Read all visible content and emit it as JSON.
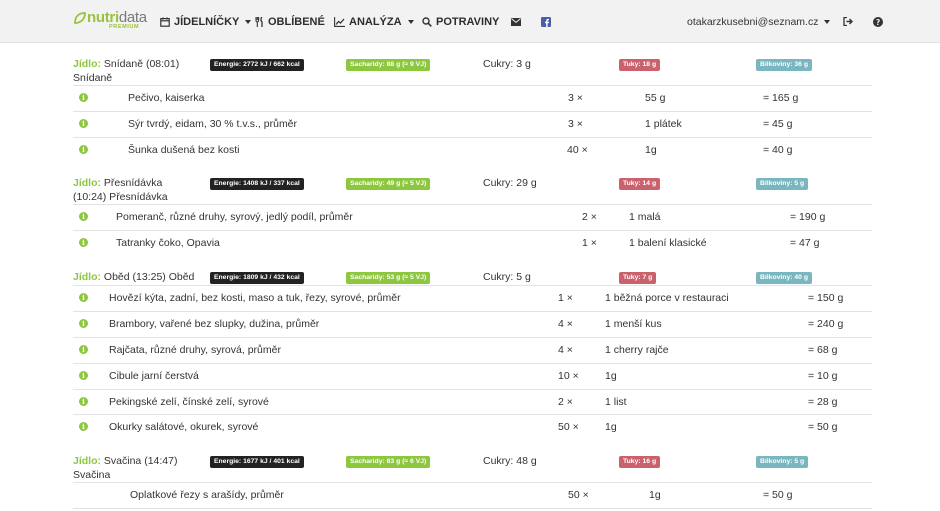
{
  "nav": {
    "logo_main": "nutri",
    "logo_data": "data",
    "logo_premium": "PREMIUM",
    "menu_jidelnicky": "JÍDELNÍČKY",
    "menu_oblibene": "OBLÍBENÉ",
    "menu_analyza": "ANALÝZA",
    "menu_potraviny": "POTRAVINY",
    "user_email": "otakarzkusebni@seznam.cz"
  },
  "colors": {
    "brand_green": "#8dc63f",
    "energy_badge": "#222222",
    "fat_badge": "#c9626c",
    "protein_badge": "#7ab6bf"
  },
  "meals": [
    {
      "title_label": "Jídlo:",
      "title_text": "Snídaně (08:01)",
      "subtitle": "Snídaně",
      "energy": "Energie: 2772 kJ / 662 kcal",
      "carbs": "Sacharidy: 88 g (≈ 9 VJ)",
      "sugar": "Cukry: 3 g",
      "fat": "Tuky: 18 g",
      "protein": "Bílkoviny: 36 g",
      "items": [
        {
          "name": "Pečivo, kaiserka",
          "count": "3 ×",
          "unit": "55 g",
          "total": "= 165 g"
        },
        {
          "name": "Sýr tvrdý, eidam, 30 % t.v.s., průměr",
          "count": "3 ×",
          "unit": "1 plátek",
          "total": "= 45 g"
        },
        {
          "name": "Šunka dušená bez kosti",
          "count": "40 ×",
          "unit": "1g",
          "total": "= 40 g"
        }
      ]
    },
    {
      "title_label": "Jídlo:",
      "title_text": "Přesnídávka",
      "subtitle": "(10:24) Přesnídávka",
      "energy": "Energie: 1408 kJ / 337 kcal",
      "carbs": "Sacharidy: 49 g (≈ 5 VJ)",
      "sugar": "Cukry: 29 g",
      "fat": "Tuky: 14 g",
      "protein": "Bílkoviny: 5 g",
      "items": [
        {
          "name": "Pomeranč, různé druhy, syrový, jedlý podíl, průměr",
          "count": "2 ×",
          "unit": "1 malá",
          "total": "= 190 g"
        },
        {
          "name": "Tatranky čoko, Opavia",
          "count": "1 ×",
          "unit": "1 balení klasické",
          "total": "= 47 g"
        }
      ]
    },
    {
      "title_label": "Jídlo:",
      "title_text": "Oběd (13:25) Oběd",
      "subtitle": "",
      "energy": "Energie: 1809 kJ / 432 kcal",
      "carbs": "Sacharidy: 53 g (≈ 5 VJ)",
      "sugar": "Cukry: 5 g",
      "fat": "Tuky: 7 g",
      "protein": "Bílkoviny: 40 g",
      "items": [
        {
          "name": "Hovězí kýta, zadní, bez kosti, maso a tuk, řezy, syrové, průměr",
          "count": "1 ×",
          "unit": "1 běžná porce v restauraci",
          "total": "= 150 g"
        },
        {
          "name": "Brambory, vařené bez slupky, dužina, průměr",
          "count": "4 ×",
          "unit": "1 menší kus",
          "total": "= 240 g"
        },
        {
          "name": "Rajčata, různé druhy, syrová, průměr",
          "count": "4 ×",
          "unit": "1 cherry rajče",
          "total": "= 68 g"
        },
        {
          "name": "Cibule jarní čerstvá",
          "count": "10 ×",
          "unit": "1g",
          "total": "= 10 g"
        },
        {
          "name": "Pekingské zelí, čínské zelí, syrové",
          "count": "2 ×",
          "unit": "1 list",
          "total": "= 28 g"
        },
        {
          "name": "Okurky salátové, okurek, syrové",
          "count": "50 ×",
          "unit": "1g",
          "total": "= 50 g"
        }
      ]
    },
    {
      "title_label": "Jídlo:",
      "title_text": "Svačina (14:47)",
      "subtitle": "Svačina",
      "energy": "Energie: 1677 kJ / 401 kcal",
      "carbs": "Sacharidy: 63 g (≈ 6 VJ)",
      "sugar": "Cukry: 48 g",
      "fat": "Tuky: 16 g",
      "protein": "Bílkoviny: 5 g",
      "items": [
        {
          "name": "Oplatkové řezy s arašídy, průměr",
          "count": "50 ×",
          "unit": "1g",
          "total": "= 50 g"
        }
      ]
    }
  ]
}
